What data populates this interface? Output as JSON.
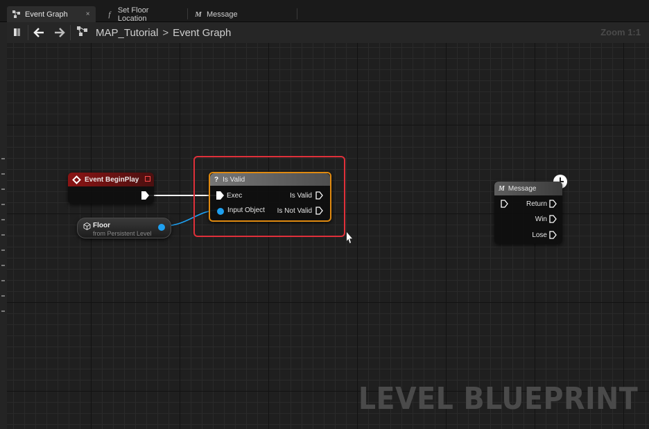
{
  "tabs": [
    {
      "label": "Event Graph",
      "icon": "event-graph-icon",
      "active": true,
      "close": "×"
    },
    {
      "label": "Set Floor Location",
      "icon": "function-icon",
      "glyph": "f"
    },
    {
      "label": "Message",
      "icon": "macro-icon",
      "glyph": "M"
    }
  ],
  "breadcrumb": {
    "map": "MAP_Tutorial",
    "separator": ">",
    "graph": "Event Graph"
  },
  "zoom_label": "Zoom 1:1",
  "nodes": {
    "begin_play": {
      "title": "Event BeginPlay",
      "color": "#8a1414"
    },
    "floor": {
      "title": "Floor",
      "subtitle": "from Persistent Level"
    },
    "is_valid": {
      "title": "Is Valid",
      "prefix": "?",
      "inputs": {
        "exec": "Exec",
        "object": "Input Object"
      },
      "outputs": {
        "valid": "Is Valid",
        "not_valid": "Is Not Valid"
      },
      "border_color": "#e08a10"
    },
    "message": {
      "title": "Message",
      "prefix": "M",
      "outputs": {
        "return": "Return",
        "win": "Win",
        "lose": "Lose"
      }
    }
  },
  "highlight_color": "#e0303a",
  "watermark": "LEVEL BLUEPRINT"
}
